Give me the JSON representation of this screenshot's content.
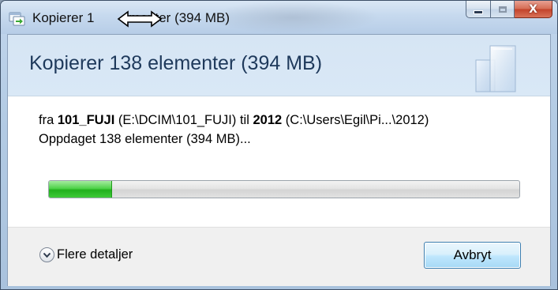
{
  "window": {
    "title_prefix": "Kopierer 1",
    "title_suffix": "menter (394 MB)",
    "close_glyph": "X"
  },
  "header": {
    "title": "Kopierer 138 elementer (394 MB)"
  },
  "transfer": {
    "from_word": "fra",
    "source_name": "101_FUJI",
    "source_path": "(E:\\DCIM\\101_FUJI)",
    "to_word": "til",
    "dest_name": "2012",
    "dest_path": "(C:\\Users\\Egil\\Pi...\\2012)",
    "status": "Oppdaget 138 elementer (394 MB)...",
    "progress_fraction": 0.135
  },
  "footer": {
    "details_label": "Flere detaljer",
    "cancel_label": "Avbryt"
  },
  "icons": {
    "app": "copy-icon",
    "cursor": "resize-horizontal-cursor",
    "details": "chevron-down-icon"
  },
  "colors": {
    "header_text": "#1e395b",
    "progress_green": "#22b01d",
    "close_red": "#c2432b"
  }
}
